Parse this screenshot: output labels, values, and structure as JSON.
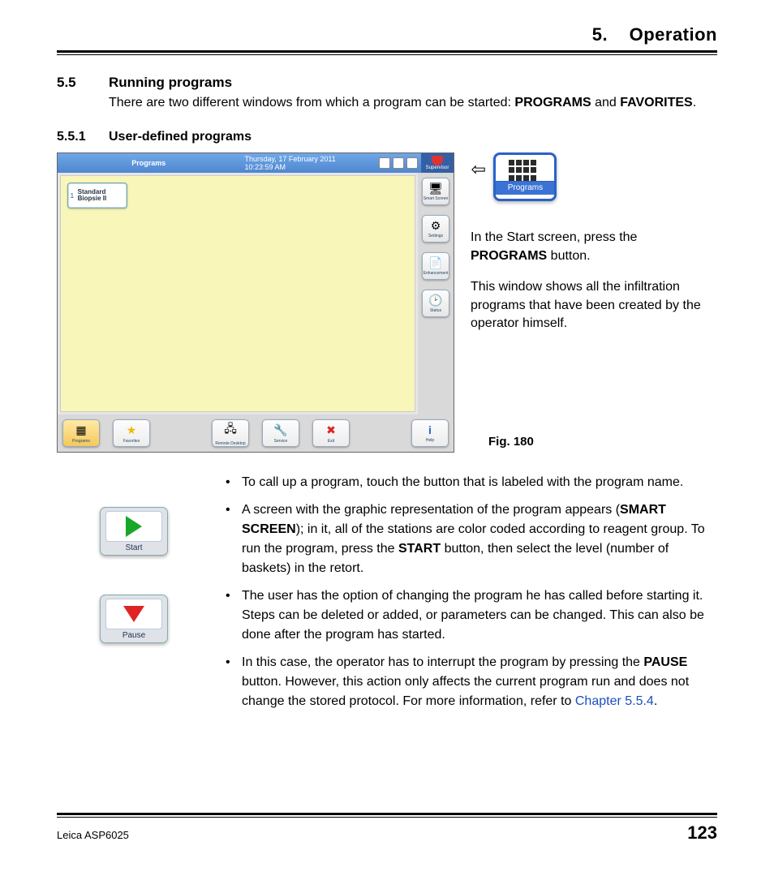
{
  "chapter": {
    "number": "5.",
    "title": "Operation"
  },
  "section": {
    "number": "5.5",
    "title": "Running programs",
    "body_prefix": "There are two different windows from which a program can be started: ",
    "word_programs": "PROGRAMS",
    "and_word": " and ",
    "word_favorites": "FAVORITES",
    "body_suffix": "."
  },
  "subsection": {
    "number": "5.5.1",
    "title": "User-defined programs"
  },
  "screenshot": {
    "title": "Programs",
    "datetime": "Thursday, 17 February 2011 10:23:59 AM",
    "supervisor_label": "Supervisor",
    "program_tile_index": "1",
    "program_tile_name": "Standard Biopsie II",
    "side_buttons": [
      {
        "name": "smart-screen-button",
        "label": "Smart Screen"
      },
      {
        "name": "settings-button",
        "label": "Settings"
      },
      {
        "name": "enhancement-button",
        "label": "Enhancement"
      },
      {
        "name": "status-button",
        "label": "Status"
      }
    ],
    "bottom_buttons": [
      {
        "name": "programs-tab",
        "label": "Programs",
        "active": true
      },
      {
        "name": "favorites-tab",
        "label": "Favorites",
        "active": false
      },
      {
        "name": "remote-button",
        "label": "Remote Desktop",
        "active": false
      },
      {
        "name": "service-button",
        "label": "Service",
        "active": false
      },
      {
        "name": "exit-button",
        "label": "Exit",
        "active": false
      },
      {
        "name": "help-button",
        "label": "Help",
        "active": false
      }
    ]
  },
  "programs_large_btn": {
    "caption": "Programs"
  },
  "right_text": {
    "p1_a": "In the Start screen, press the ",
    "p1_b": "PROGRAMS",
    "p1_c": " button.",
    "p2": "This window shows all the infiltration programs that have been created by the operator himself."
  },
  "figure_caption": "Fig. 180",
  "start_btn": {
    "label": "Start"
  },
  "pause_btn": {
    "label": "Pause"
  },
  "bullets": {
    "b1": "To call up a program, touch the button that is labeled with the program name.",
    "b2_a": "A screen with the graphic representation of the program appears (",
    "b2_b": "SMART SCREEN",
    "b2_c": "); in it, all of the stations are color coded according to reagent group. To run the program, press the ",
    "b2_d": "START",
    "b2_e": " button, then select the level (number of baskets) in the retort.",
    "b3": "The user has the option of changing the program he has called before starting it. Steps can be deleted or added, or parameters can be changed. This can also be done after the program has started.",
    "b4_a": "In this case, the operator has to interrupt the program by pressing the ",
    "b4_b": "PAUSE",
    "b4_c": " button. However, this action only affects the current program run and does not change the stored protocol. For more information, refer to ",
    "b4_link": "Chapter 5.5.4",
    "b4_d": "."
  },
  "footer": {
    "left": "Leica ASP6025",
    "right": "123"
  }
}
